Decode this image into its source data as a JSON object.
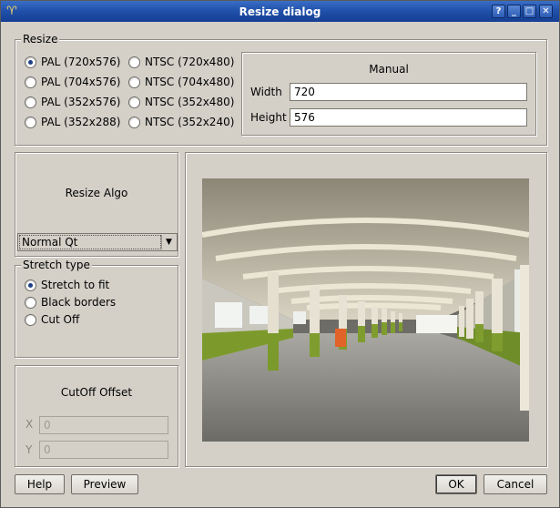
{
  "window": {
    "title": "Resize dialog"
  },
  "titlebar_buttons": [
    "?",
    "_",
    "□",
    "✕"
  ],
  "resize": {
    "legend": "Resize",
    "presets": [
      {
        "label": "PAL (720x576)",
        "checked": true
      },
      {
        "label": "PAL (704x576)",
        "checked": false
      },
      {
        "label": "PAL (352x576)",
        "checked": false
      },
      {
        "label": "PAL (352x288)",
        "checked": false
      },
      {
        "label": "NTSC (720x480)",
        "checked": false
      },
      {
        "label": "NTSC (704x480)",
        "checked": false
      },
      {
        "label": "NTSC (352x480)",
        "checked": false
      },
      {
        "label": "NTSC (352x240)",
        "checked": false
      }
    ],
    "manual": {
      "title": "Manual",
      "width_label": "Width",
      "width_value": "720",
      "height_label": "Height",
      "height_value": "576"
    }
  },
  "algo": {
    "title": "Resize Algo",
    "selected": "Normal Qt"
  },
  "stretch": {
    "legend": "Stretch type",
    "options": [
      {
        "label": "Stretch to fit",
        "checked": true
      },
      {
        "label": "Black borders",
        "checked": false
      },
      {
        "label": "Cut Off",
        "checked": false
      }
    ]
  },
  "cutoff": {
    "title": "CutOff Offset",
    "x_label": "X",
    "x_value": "0",
    "y_label": "Y",
    "y_value": "0"
  },
  "buttons": {
    "help": "Help",
    "preview": "Preview",
    "ok": "OK",
    "cancel": "Cancel"
  },
  "colors": {
    "titlebar": "#2a5cb8",
    "dialog_bg": "#d4d0c8",
    "accent_green": "#7c9a2c",
    "accent_orange": "#e2632a"
  }
}
